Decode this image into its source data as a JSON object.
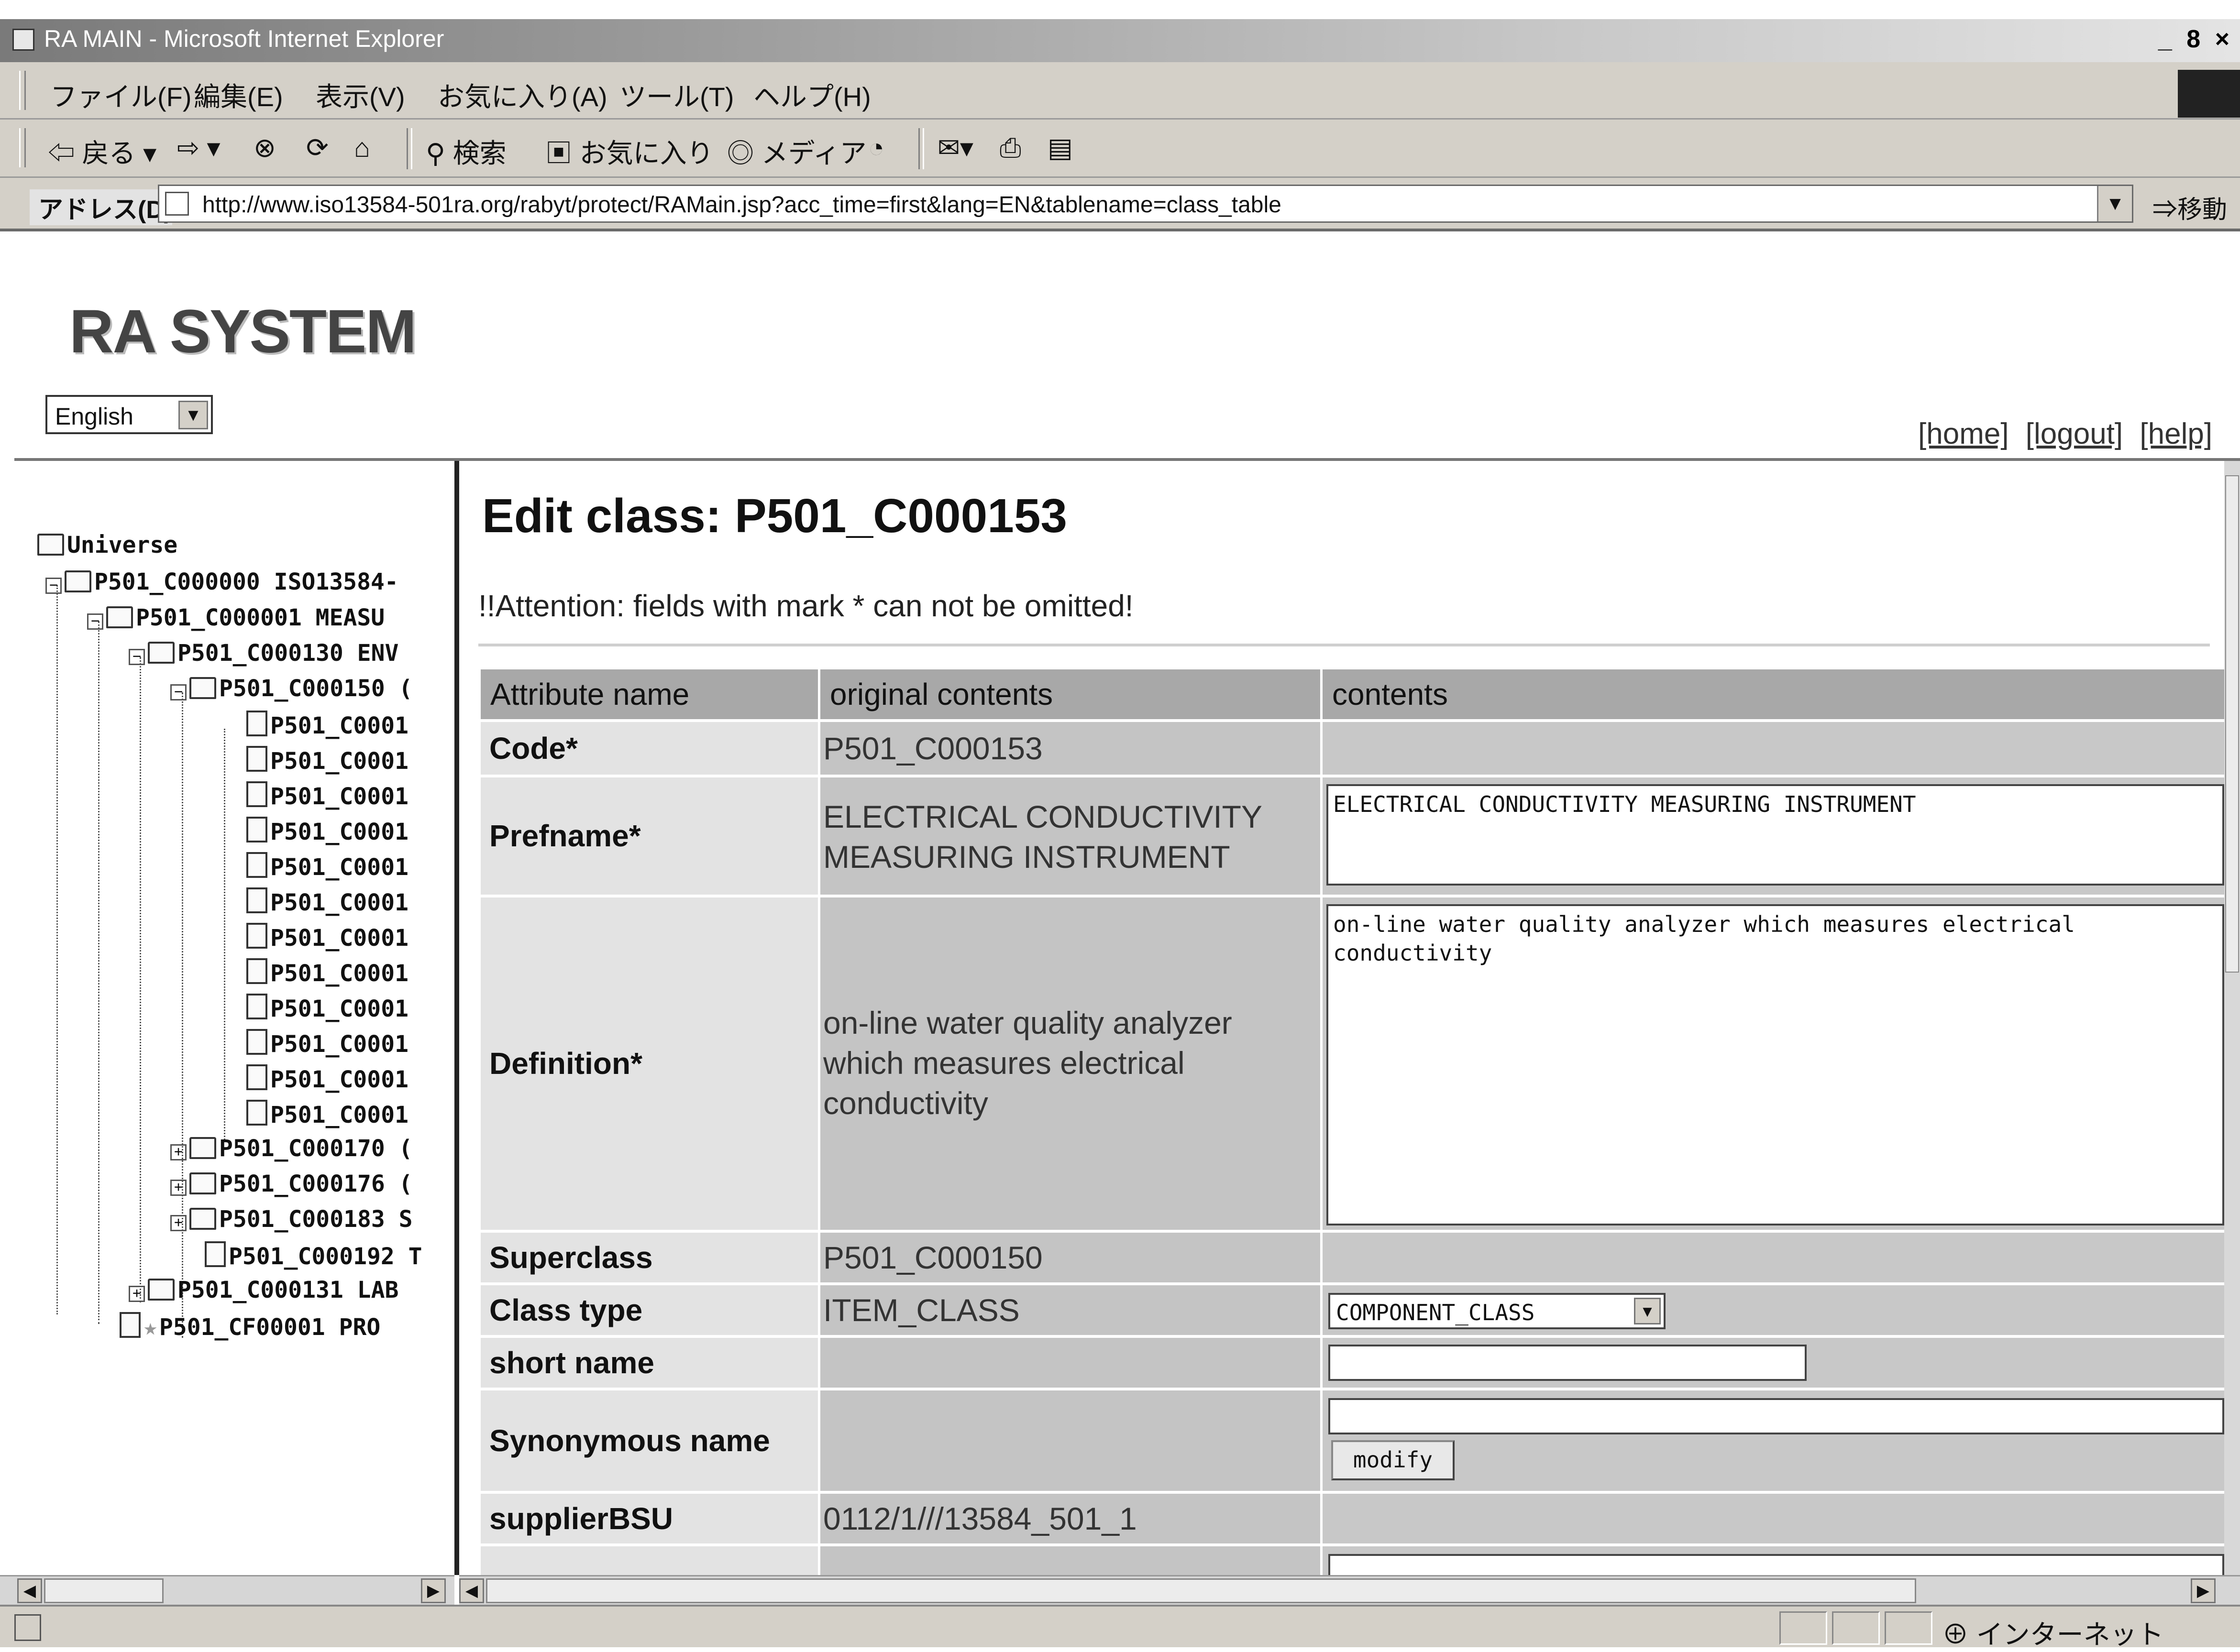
{
  "window": {
    "title": "RA MAIN - Microsoft Internet Explorer",
    "controls": "_ 8 ×"
  },
  "menu": [
    "ファイル(F)",
    "編集(E)",
    "表示(V)",
    "お気に入り(A)",
    "ツール(T)",
    "ヘルプ(H)"
  ],
  "toolbar": {
    "back": "⇦ 戻る ▾",
    "forward": "⇨ ▾",
    "search": "検索",
    "favorites": "お気に入り",
    "media": "メディア"
  },
  "address": {
    "label": "アドレス(D)",
    "url": "http://www.iso13584-501ra.org/rabyt/protect/RAMain.jsp?acc_time=first&lang=EN&tablename=class_table",
    "go": "移動"
  },
  "brand": "RA SYSTEM",
  "language": {
    "selected": "English"
  },
  "links": {
    "home": "[home]",
    "logout": "[logout]",
    "help": "[help]"
  },
  "tree": {
    "root": "Universe",
    "items": [
      "P501_C000000 ISO13584-",
      "P501_C000001 MEASU",
      "P501_C000130 ENV",
      "P501_C000150 (",
      "P501_C0001",
      "P501_C0001",
      "P501_C0001",
      "P501_C0001",
      "P501_C0001",
      "P501_C0001",
      "P501_C0001",
      "P501_C0001",
      "P501_C0001",
      "P501_C0001",
      "P501_C0001",
      "P501_C0001",
      "P501_C000170 (",
      "P501_C000176 (",
      "P501_C000183 S",
      "P501_C000192 T",
      "P501_C000131 LAB",
      "P501_CF00001 PRO"
    ]
  },
  "page": {
    "title": "Edit class: P501_C000153",
    "attention": "!!Attention: fields with mark * can not be omitted!"
  },
  "table": {
    "headers": [
      "Attribute name",
      "original contents",
      "contents"
    ],
    "rows": {
      "code": {
        "label": "Code*",
        "original": "P501_C000153"
      },
      "prefname": {
        "label": "Prefname*",
        "original": "ELECTRICAL CONDUCTIVITY MEASURING INSTRUMENT",
        "value": "ELECTRICAL CONDUCTIVITY MEASURING INSTRUMENT"
      },
      "definition": {
        "label": "Definition*",
        "original": "on-line water quality analyzer which measures electrical conductivity",
        "value": "on-line water quality analyzer which measures electrical conductivity"
      },
      "superclass": {
        "label": "Superclass",
        "original": "P501_C000150"
      },
      "classtype": {
        "label": "Class type",
        "original": "ITEM_CLASS",
        "value": "COMPONENT_CLASS"
      },
      "shortname": {
        "label": "short name",
        "original": "",
        "value": ""
      },
      "synonymous": {
        "label": "Synonymous name",
        "original": "",
        "value": "",
        "button": "modify"
      },
      "supplier": {
        "label": "supplierBSU",
        "original": "0112/1///13584_501_1"
      }
    }
  },
  "status": {
    "zone": "インターネット"
  }
}
